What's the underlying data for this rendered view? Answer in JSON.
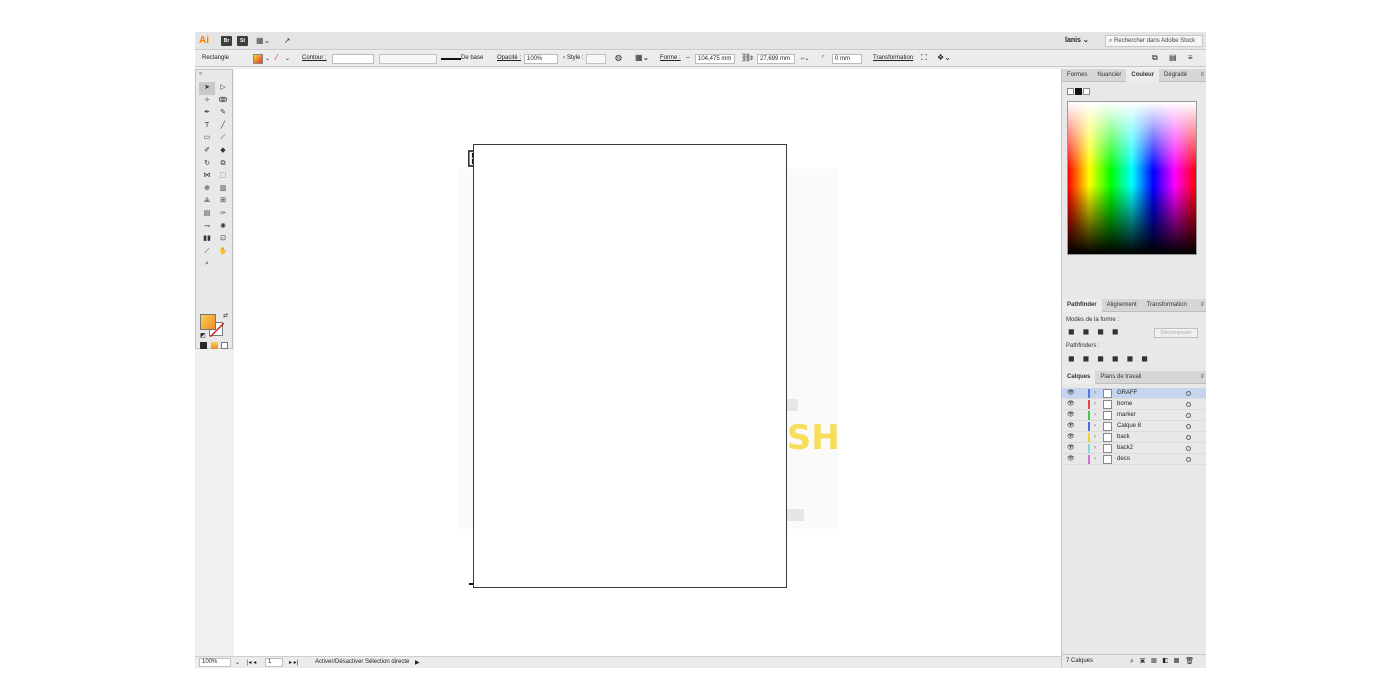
{
  "appbar": {
    "logo": "Ai",
    "badges": [
      "Br",
      "St"
    ],
    "user": "lanis ⌄",
    "search_placeholder": "Rechercher dans Adobe Stock"
  },
  "controlbar": {
    "selection_type": "Rectangle",
    "stroke_label": "Contour :",
    "stroke_style": "De base",
    "opacity_label": "Opacité :",
    "opacity_value": "100%",
    "style_label": "Style :",
    "shape_label": "Forme :",
    "width_value": "104,475 mm",
    "height_value": "27,699 mm",
    "radius_value": "0 mm",
    "transform_label": "Transformation"
  },
  "status": {
    "zoom": "100%",
    "artboard_num": "1",
    "message": "Activer/Désactiver Sélection directe"
  },
  "color_panel": {
    "tabs": [
      "Formes",
      "Nuancier",
      "Couleur",
      "Dégradé"
    ],
    "active_tab": 2
  },
  "pathfinder_panel": {
    "tabs": [
      "Pathfinder",
      "Alignement",
      "Transformation"
    ],
    "modes_label": "Modes de la forme :",
    "pathfinders_label": "Pathfinders :",
    "expand_button": "Décomposer"
  },
  "layers_panel": {
    "tabs": [
      "Calques",
      "Plans de travail"
    ],
    "layers": [
      {
        "name": "GRAFF",
        "color": "#4f7ae0",
        "selected": true
      },
      {
        "name": "borne",
        "color": "#e04848",
        "selected": false
      },
      {
        "name": "marker",
        "color": "#49c24e",
        "selected": false
      },
      {
        "name": "Calque 8",
        "color": "#4b6fe0",
        "selected": false
      },
      {
        "name": "back",
        "color": "#f1d23a",
        "selected": false
      },
      {
        "name": "back2",
        "color": "#7fd9d9",
        "selected": false
      },
      {
        "name": "deco",
        "color": "#d46bd4",
        "selected": false
      }
    ],
    "footer_count": "7 Calques"
  },
  "colors": {
    "accent_selection": "#c5d5f0"
  }
}
